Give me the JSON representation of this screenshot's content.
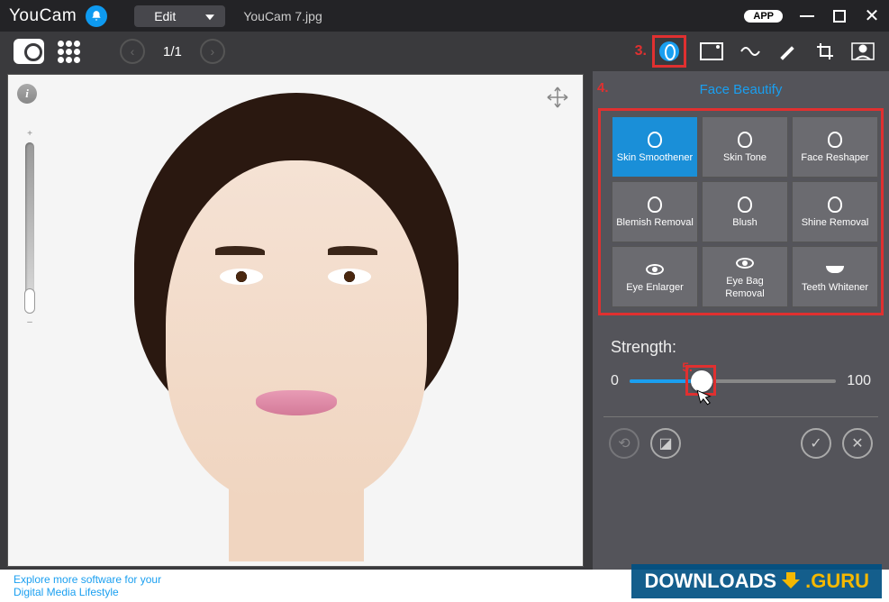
{
  "titlebar": {
    "app_name": "YouCam",
    "mode": "Edit",
    "filename": "YouCam 7.jpg",
    "app_badge": "APP"
  },
  "toolbar": {
    "pager": "1/1",
    "annotation_3": "3."
  },
  "panel": {
    "title": "Face Beautify",
    "annotation_4": "4.",
    "tools": [
      {
        "label": "Skin Smoothener",
        "icon": "head",
        "active": true
      },
      {
        "label": "Skin Tone",
        "icon": "head",
        "active": false
      },
      {
        "label": "Face Reshaper",
        "icon": "head",
        "active": false
      },
      {
        "label": "Blemish Removal",
        "icon": "head",
        "active": false
      },
      {
        "label": "Blush",
        "icon": "head",
        "active": false
      },
      {
        "label": "Shine Removal",
        "icon": "head",
        "active": false
      },
      {
        "label": "Eye Enlarger",
        "icon": "eye",
        "active": false
      },
      {
        "label": "Eye Bag Removal",
        "icon": "eye",
        "active": false
      },
      {
        "label": "Teeth Whitener",
        "icon": "teeth",
        "active": false
      }
    ],
    "strength": {
      "label": "Strength:",
      "min": "0",
      "max": "100",
      "value_pct": 35,
      "annotation_5": "5."
    }
  },
  "viewer": {
    "zoom_plus": "+",
    "zoom_minus": "–"
  },
  "footer": {
    "line1": "Explore more software for your",
    "line2": "Digital Media Lifestyle",
    "watermark_left": "DOWNLOADS",
    "watermark_dot": ".",
    "watermark_right": "GURU"
  }
}
